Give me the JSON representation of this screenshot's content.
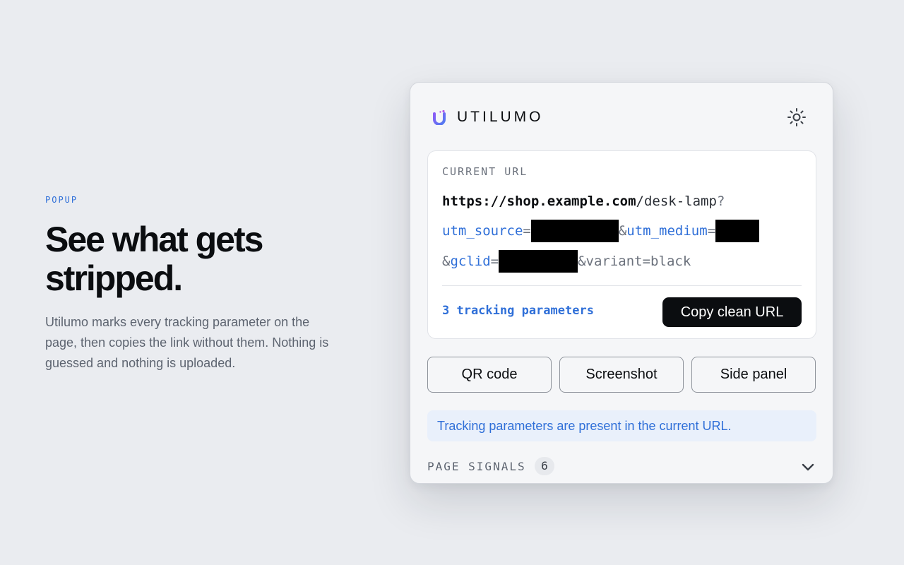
{
  "intro": {
    "eyebrow": "POPUP",
    "headline_line1": "See what gets",
    "headline_line2": "stripped.",
    "description": "Utilumo marks every tracking parameter on the page, then copies the link without them. Nothing is guessed and nothing is uploaded."
  },
  "popup": {
    "brand": "UTILUMO",
    "logo_icon": "utilumo-logo-icon",
    "theme_icon": "sun-icon",
    "url_card": {
      "label": "CURRENT URL",
      "url_host": "https://shop.example.com",
      "url_path": "/desk-lamp",
      "url_query_mark": "?",
      "param1_name": "utm_source",
      "param1_eq": "=",
      "param2_prefix": "&",
      "param2_name": "utm_medium",
      "param2_eq": "=",
      "param3_prefix": "&",
      "param3_name": "gclid",
      "param3_eq": "=",
      "param4": "&variant=black",
      "tracking_count_text": "3 tracking parameters",
      "copy_button": "Copy clean URL"
    },
    "actions": [
      "QR code",
      "Screenshot",
      "Side panel"
    ],
    "notice": "Tracking parameters are present in the current URL.",
    "signals": {
      "label": "PAGE SIGNALS",
      "count": "6",
      "chevron_icon": "chevron-down-icon"
    }
  },
  "colors": {
    "accent": "#2f6fd8",
    "background": "#eaecf0",
    "primary_button": "#0b0d10",
    "notice_bg": "#e9f0fb"
  }
}
